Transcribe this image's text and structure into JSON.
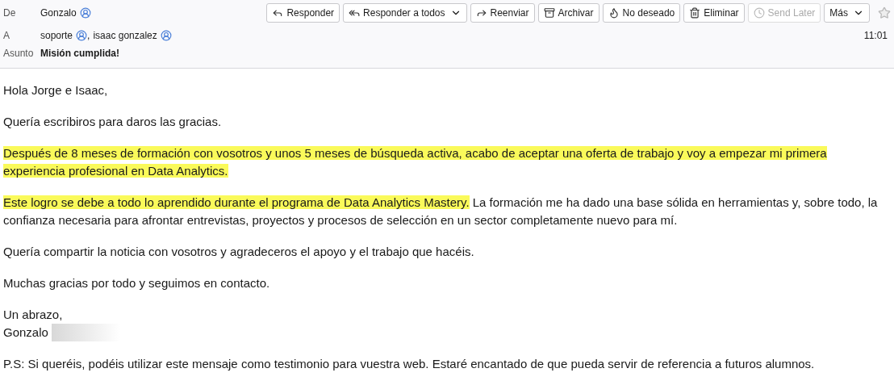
{
  "header": {
    "from_label": "De",
    "from": [
      {
        "name": "Gonzalo"
      }
    ],
    "to_label": "A",
    "to_separator": ",",
    "to": [
      {
        "name": "soporte"
      },
      {
        "name": "isaac gonzalez"
      }
    ],
    "subject_label": "Asunto",
    "subject": "Misión cumplida!",
    "time": "11:01",
    "starred": false
  },
  "toolbar": [
    {
      "label": "Responder",
      "disabled": false
    },
    {
      "label": "Responder a todos",
      "disabled": false,
      "has_menu": true
    },
    {
      "label": "Reenviar",
      "disabled": false
    },
    {
      "label": "Archivar",
      "disabled": false
    },
    {
      "label": "No deseado",
      "disabled": false
    },
    {
      "label": "Eliminar",
      "disabled": false
    },
    {
      "label": "Send Later",
      "disabled": true
    },
    {
      "label": "Más",
      "disabled": false,
      "has_menu": true
    }
  ],
  "body": [
    {
      "kind": "paragraph",
      "segments": [
        {
          "text": "Hola Jorge e Isaac,",
          "highlighted": false
        }
      ]
    },
    {
      "kind": "paragraph",
      "segments": [
        {
          "text": "Quería escribiros para daros las gracias.",
          "highlighted": false
        }
      ]
    },
    {
      "kind": "paragraph",
      "segments": [
        {
          "text": "Después de 8 meses de formación con vosotros y unos 5 meses de búsqueda activa, acabo de aceptar una oferta de trabajo y voy a empezar mi primera experiencia profesional en Data Analytics.",
          "highlighted": true
        }
      ]
    },
    {
      "kind": "paragraph",
      "segments": [
        {
          "text": "Este logro se debe a todo lo aprendido durante el programa de Data Analytics Mastery.",
          "highlighted": true
        },
        {
          "text": " La formación me ha dado una base sólida en herramientas y, sobre todo, la confianza necesaria para afrontar entrevistas, proyectos y procesos de selección en un sector completamente nuevo para mí.",
          "highlighted": false
        }
      ]
    },
    {
      "kind": "paragraph",
      "segments": [
        {
          "text": "Quería compartir la noticia con vosotros y agradeceros el apoyo y el trabajo que hacéis.",
          "highlighted": false
        }
      ]
    },
    {
      "kind": "paragraph",
      "segments": [
        {
          "text": "Muchas gracias por todo y seguimos en contacto.",
          "highlighted": false
        }
      ]
    },
    {
      "kind": "signature",
      "closing": "Un abrazo,",
      "name": "Gonzalo",
      "redacted": true
    },
    {
      "kind": "paragraph",
      "segments": [
        {
          "text": "P.S: Si queréis, podéis utilizar este mensaje como testimonio para vuestra web. Estaré encantado de que pueda servir de referencia a futuros alumnos.",
          "highlighted": false
        }
      ]
    }
  ]
}
